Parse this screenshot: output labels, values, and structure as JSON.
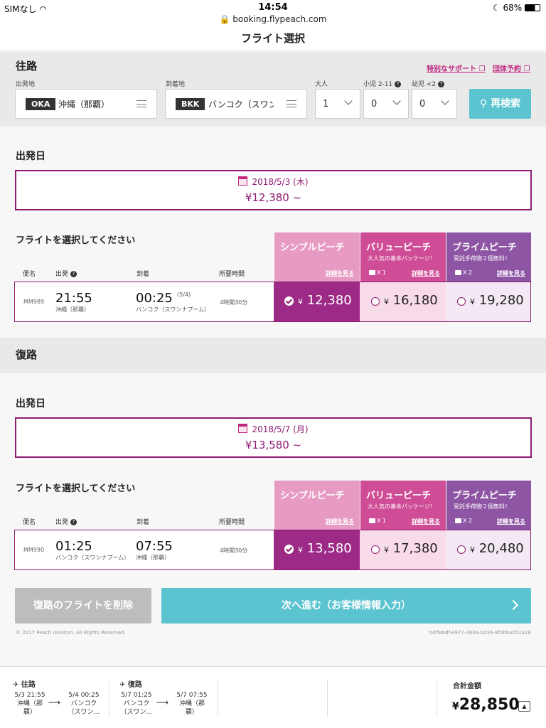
{
  "status": {
    "carrier": "SIMなし",
    "time": "14:54",
    "battery": "68%"
  },
  "browser": {
    "url": "booking.flypeach.com"
  },
  "page": {
    "title": "フライト選択"
  },
  "search": {
    "section_title": "往路",
    "special_support": "特別なサポート",
    "group_booking": "団体予約",
    "origin_label": "出発地",
    "origin_code": "OKA",
    "origin_city": "沖縄（那覇）",
    "dest_label": "到着地",
    "dest_code": "BKK",
    "dest_city": "バンコク（スワンナ",
    "adult_label": "大人",
    "adult_value": "1",
    "child_label": "小児 2-11",
    "child_value": "0",
    "infant_label": "幼児 <2",
    "infant_value": "0",
    "research_label": "再検索"
  },
  "outbound": {
    "date_section": "出発日",
    "date": "2018/5/3 (木)",
    "lowest_price": "¥12,380 ~",
    "select_title": "フライトを選択してください",
    "cols": {
      "flight_no": "便名",
      "depart": "出発",
      "arrive": "到着",
      "duration": "所要時間"
    },
    "flight": {
      "number": "MM989",
      "dep_time": "21:55",
      "dep_place": "沖縄（那覇）",
      "arr_time": "00:25",
      "arr_note": "(5/4)",
      "arr_place": "バンコク（スワンナプーム）",
      "duration": "4時間30分",
      "simple_price": "12,380",
      "value_price": "16,180",
      "prime_price": "19,280"
    }
  },
  "return_trip": {
    "section_title": "復路",
    "date_section": "出発日",
    "date": "2018/5/7 (月)",
    "lowest_price": "¥13,580 ~",
    "select_title": "フライトを選択してください",
    "cols": {
      "flight_no": "便名",
      "depart": "出発",
      "arrive": "到着",
      "duration": "所要時間"
    },
    "flight": {
      "number": "MM990",
      "dep_time": "01:25",
      "dep_place": "バンコク（スワンナプーム）",
      "arr_time": "07:55",
      "arr_place": "沖縄（那覇）",
      "duration": "4時間30分",
      "simple_price": "13,580",
      "value_price": "17,380",
      "prime_price": "20,480"
    }
  },
  "fares": {
    "yen": "¥",
    "simple": {
      "name": "シンプルピーチ",
      "detail": "詳細を見る",
      "color": "#e79ac2",
      "selected_color": "#9c2a86"
    },
    "value": {
      "name": "バリューピーチ",
      "sub": "大人気の基本パッケージ！",
      "bag": "X 1",
      "detail": "詳細を見る",
      "color": "#cf4d96",
      "cell_color": "#f8dbe9"
    },
    "prime": {
      "name": "プライムピーチ",
      "sub": "受託手荷物２個無料！",
      "bag": "X 2",
      "detail": "詳細を見る",
      "color": "#8e55a5",
      "cell_color": "#f3e8f3"
    }
  },
  "actions": {
    "delete_return": "復路のフライトを削除",
    "next": "次へ進む（お客様情報入力）"
  },
  "footer": {
    "copyright": "© 2017 Peach Aviation. All Rights Reserved.",
    "session_id": "b4ffebdf-e977-480a-bd36-8fbbbab51a28"
  },
  "summary": {
    "out_label": "往路",
    "out_dep_dt": "5/3 21:55",
    "out_dep_place": "沖縄（那",
    "out_dep_place2": "覇）",
    "out_arr_dt": "5/4 00:25",
    "out_arr_place": "バンコク",
    "out_arr_place2": "（スワン…",
    "ret_label": "復路",
    "ret_dep_dt": "5/7 01:25",
    "ret_dep_place": "バンコク",
    "ret_dep_place2": "（スワン…",
    "ret_arr_dt": "5/7 07:55",
    "ret_arr_place": "沖縄（那",
    "ret_arr_place2": "覇）",
    "total_label": "合計金額",
    "total_currency": "¥",
    "total_amount": "28,850"
  }
}
